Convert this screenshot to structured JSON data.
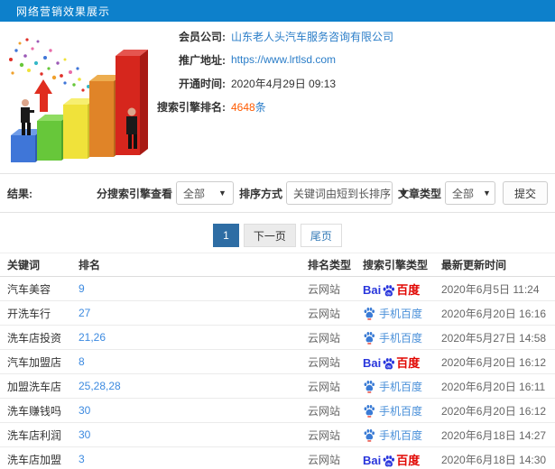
{
  "header": {
    "title": "网络营销效果展示"
  },
  "info": {
    "rows": [
      {
        "label": "会员公司:",
        "value": "山东老人头汽车服务咨询有限公司"
      },
      {
        "label": "推广地址:",
        "value": "https://www.lrtlsd.com"
      },
      {
        "label": "开通时间:",
        "value": "2020年4月29日 09:13"
      },
      {
        "label": "搜索引擎排名:",
        "value": "4648",
        "suffix": "条"
      }
    ]
  },
  "filters": {
    "result_label": "结果:",
    "engine_label": "分搜索引擎查看",
    "engine_value": "全部",
    "sort_label": "排序方式",
    "sort_value": "关键词由短到长排序",
    "article_label": "文章类型",
    "article_value": "全部",
    "submit_label": "提交",
    "caret": "▼"
  },
  "pagination": {
    "current": "1",
    "next": "下一页",
    "last": "尾页"
  },
  "table": {
    "headers": [
      "关键词",
      "排名",
      "排名类型",
      "搜索引擎类型",
      "最新更新时间"
    ],
    "engine_labels": {
      "baidu": {
        "bai": "Bai",
        "du": "du",
        "cn": "百度"
      },
      "mobile": "手机百度"
    },
    "rows": [
      {
        "keyword": "汽车美容",
        "rank": "9",
        "rank_type": "云网站",
        "engine": "baidu",
        "updated": "2020年6月5日 11:24"
      },
      {
        "keyword": "开洗车行",
        "rank": "27",
        "rank_type": "云网站",
        "engine": "mobile-baidu",
        "updated": "2020年6月20日 16:16"
      },
      {
        "keyword": "洗车店投资",
        "rank": "21,26",
        "rank_type": "云网站",
        "engine": "mobile-baidu",
        "updated": "2020年5月27日 14:58"
      },
      {
        "keyword": "汽车加盟店",
        "rank": "8",
        "rank_type": "云网站",
        "engine": "baidu",
        "updated": "2020年6月20日 16:12"
      },
      {
        "keyword": "加盟洗车店",
        "rank": "25,28,28",
        "rank_type": "云网站",
        "engine": "mobile-baidu",
        "updated": "2020年6月20日 16:11"
      },
      {
        "keyword": "洗车赚钱吗",
        "rank": "30",
        "rank_type": "云网站",
        "engine": "mobile-baidu",
        "updated": "2020年6月20日 16:12"
      },
      {
        "keyword": "洗车店利润",
        "rank": "30",
        "rank_type": "云网站",
        "engine": "mobile-baidu",
        "updated": "2020年6月18日 14:27"
      },
      {
        "keyword": "洗车店加盟",
        "rank": "3",
        "rank_type": "云网站",
        "engine": "baidu",
        "updated": "2020年6月18日 14:30"
      }
    ]
  },
  "colors": {
    "header_blue": "#0d80cb",
    "link_blue": "#2a7dc8",
    "rank_blue": "#3c8ae0",
    "highlight_orange": "#ff5a00",
    "active_page_blue": "#2e6da4",
    "baidu_blue": "#2936dc",
    "baidu_red": "#e10602"
  }
}
